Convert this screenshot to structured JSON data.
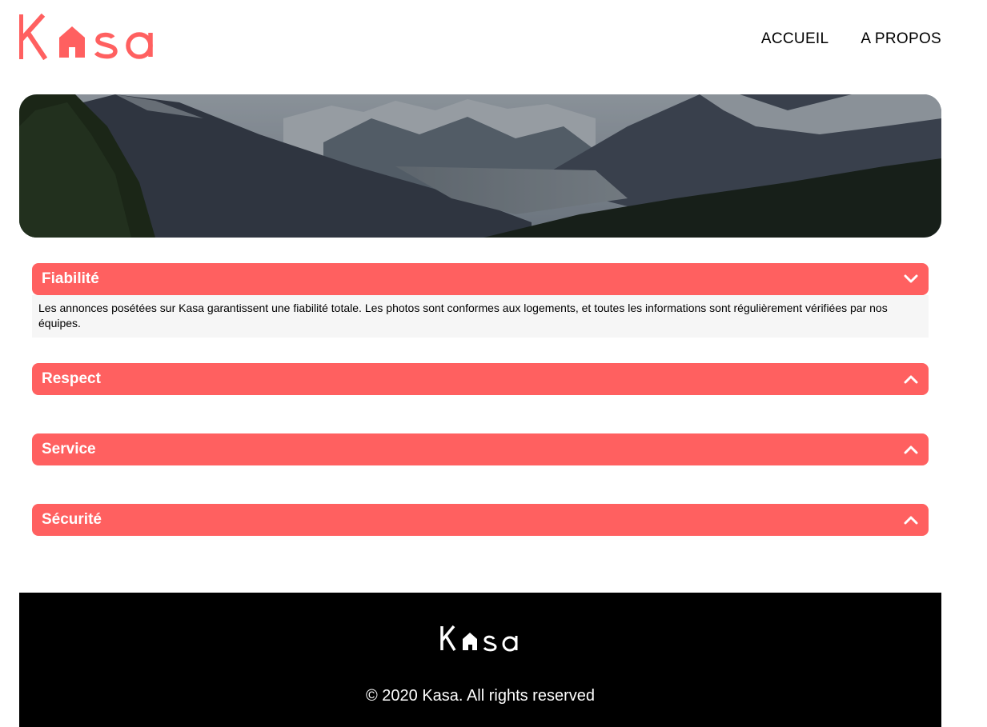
{
  "brand": {
    "name": "Kasa",
    "color": "#FF6060"
  },
  "nav": {
    "items": [
      {
        "label": "ACCUEIL"
      },
      {
        "label": "A PROPOS"
      }
    ]
  },
  "banner": {
    "image": "mountain-valley-landscape"
  },
  "collapses": [
    {
      "title": "Fiabilité",
      "icon": "chevron-down-icon",
      "open": true,
      "text": "Les annonces posétées sur Kasa garantissent une fiabilité totale. Les photos sont conformes aux logements, et toutes les informations sont régulièrement vérifiées par nos équipes."
    },
    {
      "title": "Respect",
      "icon": "chevron-up-icon",
      "open": false
    },
    {
      "title": "Service",
      "icon": "chevron-up-icon",
      "open": false
    },
    {
      "title": "Sécurité",
      "icon": "chevron-up-icon",
      "open": false
    }
  ],
  "footer": {
    "copyright": "© 2020 Kasa. All rights reserved"
  }
}
